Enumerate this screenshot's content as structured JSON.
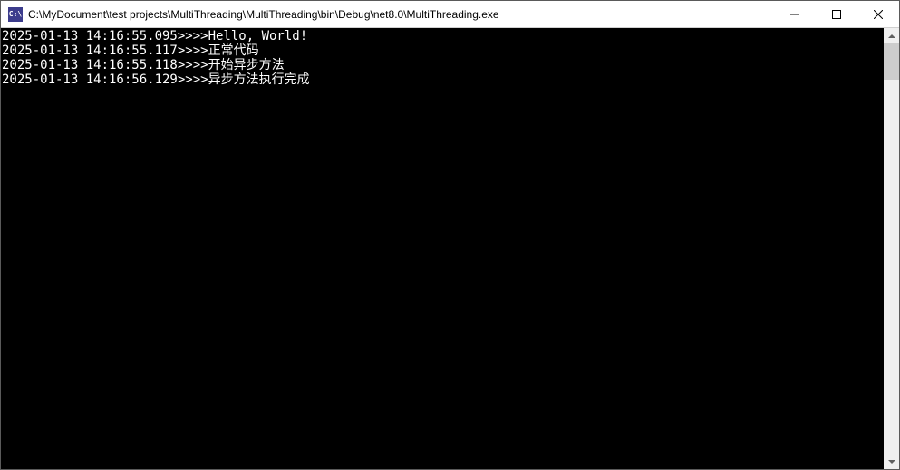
{
  "window": {
    "icon_label": "C:\\",
    "title": "C:\\MyDocument\\test projects\\MultiThreading\\MultiThreading\\bin\\Debug\\net8.0\\MultiThreading.exe"
  },
  "console": {
    "lines": [
      "2025-01-13 14:16:55.095>>>>Hello, World!",
      "2025-01-13 14:16:55.117>>>>正常代码",
      "2025-01-13 14:16:55.118>>>>开始异步方法",
      "2025-01-13 14:16:56.129>>>>异步方法执行完成"
    ]
  }
}
